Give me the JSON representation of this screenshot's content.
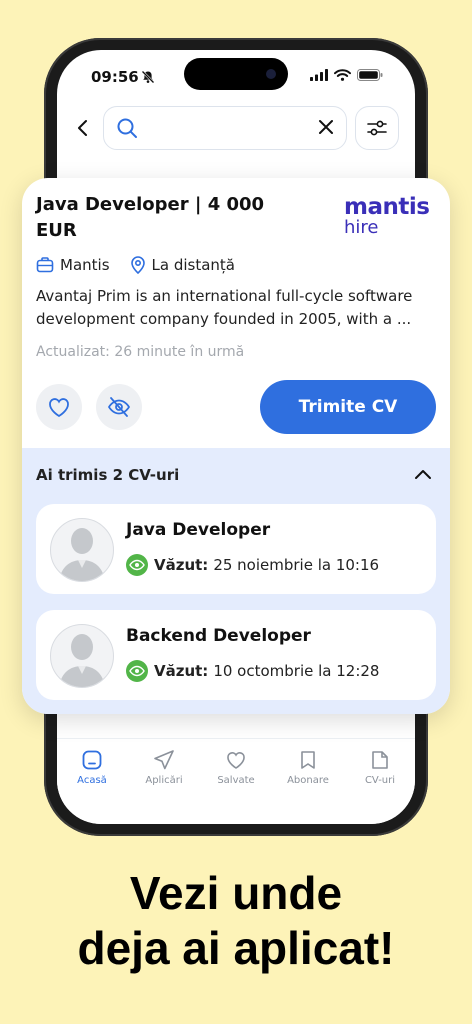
{
  "status_bar": {
    "time": "09:56"
  },
  "search": {
    "value": "",
    "placeholder": ""
  },
  "job": {
    "title": "Java Developer | 4 000 EUR",
    "company": "Mantis",
    "location": "La distanță",
    "description": "Avantaj Prim is an international full-cycle software development company founded in 2005, with a ...",
    "updated": "Actualizat: 26 minute în urmă",
    "apply_label": "Trimite CV",
    "logo": {
      "line1": "mantis",
      "line2": "hire"
    }
  },
  "applied": {
    "title": "Ai trimis 2 CV-uri",
    "items": [
      {
        "title": "Java Developer",
        "status_label": "Văzut:",
        "status_value": "25 noiembrie la 10:16"
      },
      {
        "title": "Backend Developer",
        "status_label": "Văzut:",
        "status_value": "10 octombrie la 12:28"
      }
    ]
  },
  "nav": [
    {
      "label": "Acasă",
      "icon": "home-icon"
    },
    {
      "label": "Aplicări",
      "icon": "send-icon"
    },
    {
      "label": "Salvate",
      "icon": "heart-icon"
    },
    {
      "label": "Abonare",
      "icon": "bookmark-icon"
    },
    {
      "label": "CV-uri",
      "icon": "document-icon"
    }
  ],
  "headline": {
    "line1": "Vezi unde",
    "line2": "deja ai aplicat!"
  },
  "colors": {
    "accent": "#2f6fdf",
    "background": "#fdf3b8",
    "seen": "#52b548",
    "applied_bg": "#e4ecfd"
  }
}
